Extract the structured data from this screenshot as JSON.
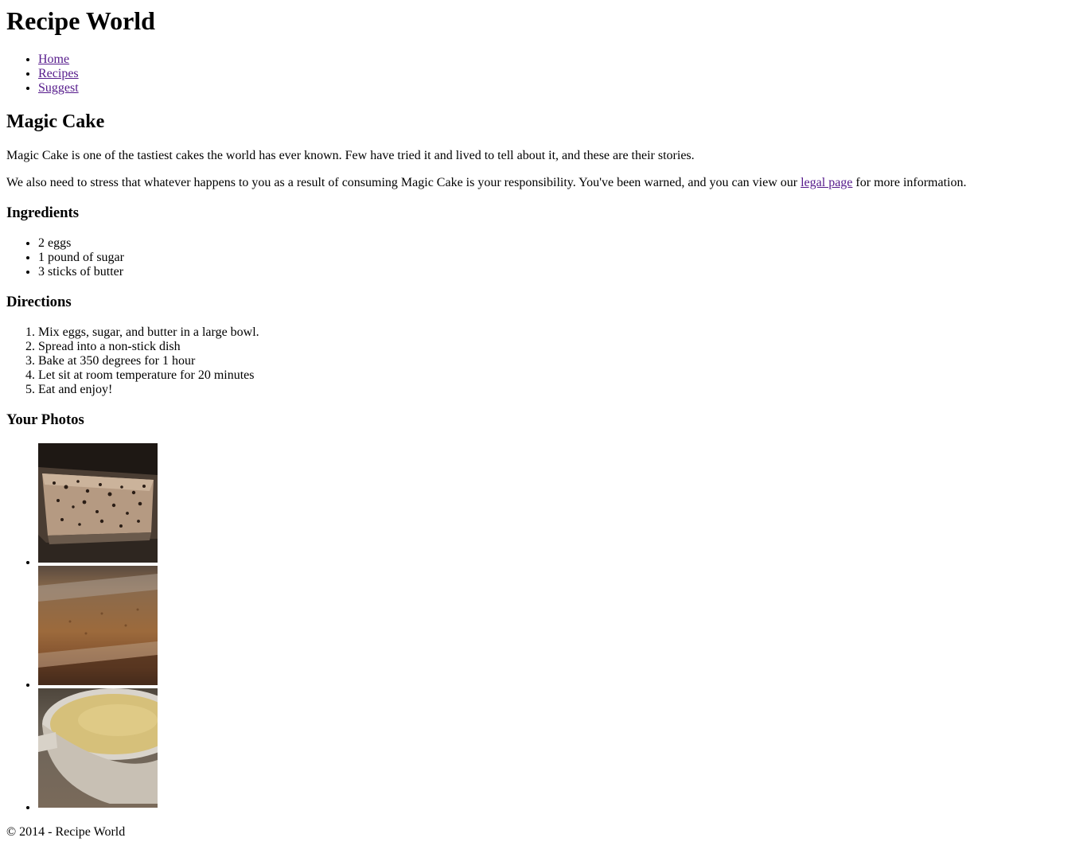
{
  "site": {
    "title": "Recipe World"
  },
  "nav": {
    "items": [
      {
        "label": "Home"
      },
      {
        "label": "Recipes"
      },
      {
        "label": "Suggest"
      }
    ]
  },
  "recipe": {
    "title": "Magic Cake",
    "intro": "Magic Cake is one of the tastiest cakes the world has ever known. Few have tried it and lived to tell about it, and these are their stories.",
    "warning_before": "We also need to stress that whatever happens to you as a result of consuming Magic Cake is your responsibility. You've been warned, and you can view our ",
    "warning_link": "legal page",
    "warning_after": " for more information.",
    "ingredients_heading": "Ingredients",
    "ingredients": [
      "2 eggs",
      "1 pound of sugar",
      "3 sticks of butter"
    ],
    "directions_heading": "Directions",
    "directions": [
      "Mix eggs, sugar, and butter in a large bowl.",
      "Spread into a non-stick dish",
      "Bake at 350 degrees for 1 hour",
      "Let sit at room temperature for 20 minutes",
      "Eat and enjoy!"
    ],
    "photos_heading": "Your Photos",
    "photos": [
      {
        "icon": "cake-in-dish-photo"
      },
      {
        "icon": "baked-cake-closeup-photo"
      },
      {
        "icon": "bowl-of-batter-photo"
      }
    ]
  },
  "footer": {
    "text": "© 2014 - Recipe World"
  },
  "colors": {
    "link_visited": "#551a8b",
    "text": "#000000",
    "background": "#ffffff"
  }
}
